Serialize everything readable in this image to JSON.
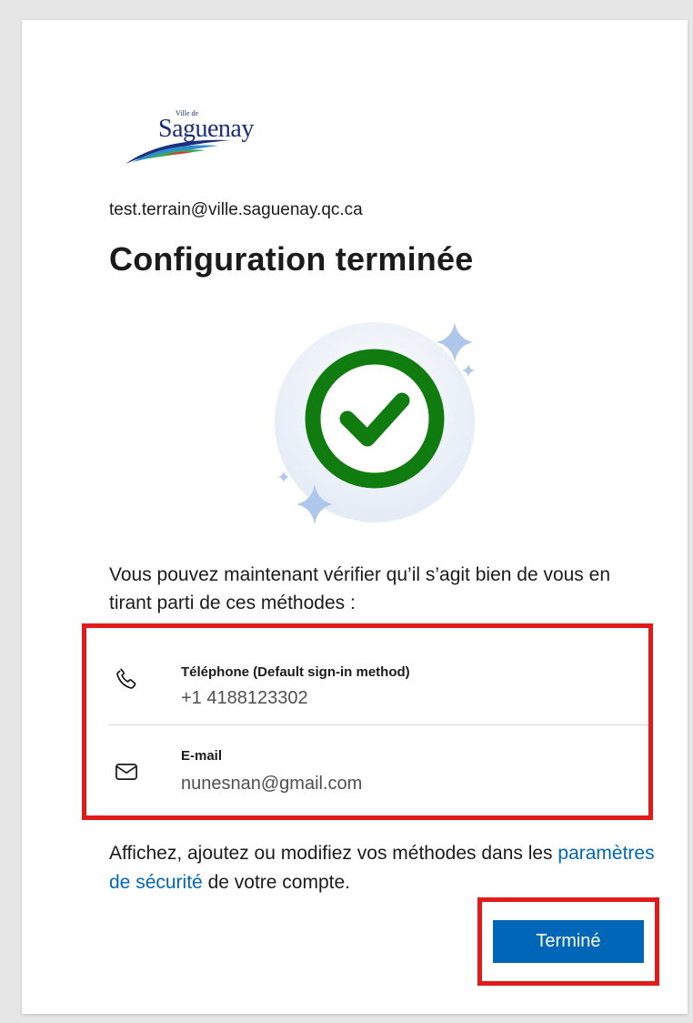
{
  "brand": {
    "logo_small": "Ville de",
    "logo_word": "Saguenay"
  },
  "account": {
    "email": "test.terrain@ville.saguenay.qc.ca"
  },
  "title": "Configuration terminée",
  "intro": "Vous pouvez maintenant vérifier qu’il s’agit bien de vous en tirant parti de ces méthodes :",
  "methods": [
    {
      "icon": "phone-icon",
      "label": "Téléphone (Default sign-in method)",
      "value": "+1 4188123302"
    },
    {
      "icon": "mail-icon",
      "label": "E-mail",
      "value": "nunesnan@gmail.com"
    }
  ],
  "footer": {
    "before": "Affichez, ajoutez ou modifiez vos méthodes dans les ",
    "link": "paramètres de sécurité",
    "after": " de votre compte."
  },
  "actions": {
    "done_label": "Terminé"
  },
  "colors": {
    "accent": "#0067b8",
    "success": "#107c10",
    "highlight": "#e21a1a"
  }
}
